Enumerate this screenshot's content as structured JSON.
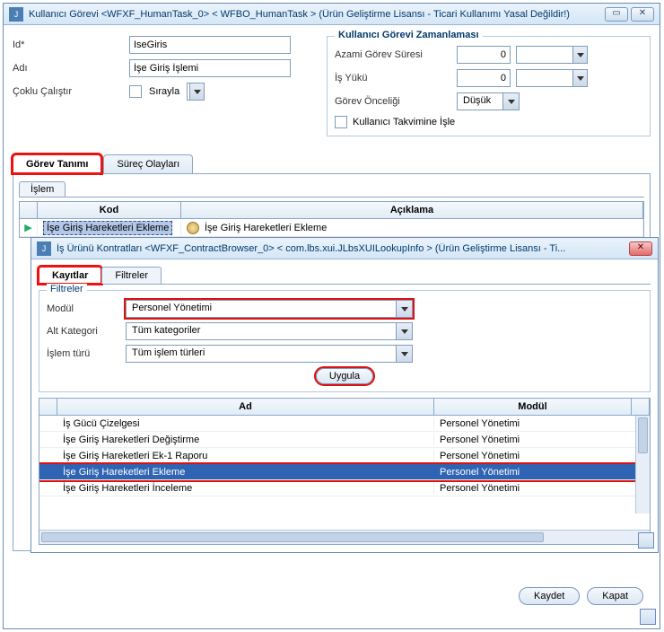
{
  "main_window": {
    "title": "Kullanıcı Görevi <WFXF_HumanTask_0> < WFBO_HumanTask > (Ürün Geliştirme Lisansı - Ticari Kullanımı Yasal Değildir!)"
  },
  "form": {
    "id_label": "Id*",
    "id_value": "IseGiris",
    "name_label": "Adı",
    "name_value": "İşe Giriş İşlemi",
    "multirun_label": "Çoklu Çalıştır",
    "sequential_label": "Sırayla"
  },
  "scheduling": {
    "legend": "Kullanıcı Görevi Zamanlaması",
    "max_duration_label": "Azami Görev Süresi",
    "max_duration_value": "0",
    "workload_label": "İş Yükü",
    "workload_value": "0",
    "priority_label": "Görev Önceliği",
    "priority_value": "Düşük",
    "process_user_calendar_label": "Kullanıcı Takvimine İşle"
  },
  "tabs": {
    "task_def": "Görev Tanımı",
    "process_events": "Süreç Olayları",
    "islem": "İşlem"
  },
  "islem_table": {
    "col_kod": "Kod",
    "col_aciklama": "Açıklama",
    "row1_kod": "İşe Giriş Hareketleri Ekleme",
    "row1_aciklama": "İşe Giriş Hareketleri Ekleme"
  },
  "popup": {
    "title": "İş Ürünü Kontratları <WFXF_ContractBrowser_0> < com.lbs.xui.JLbsXUILookupInfo > (Ürün Geliştirme Lisansı - Ti...",
    "tab_records": "Kayıtlar",
    "tab_filters": "Filtreler",
    "filters_legend": "Filtreler",
    "module_label": "Modül",
    "module_value": "Personel Yönetimi",
    "subcat_label": "Alt Kategori",
    "subcat_value": "Tüm kategoriler",
    "optype_label": "İşlem türü",
    "optype_value": "Tüm işlem türleri",
    "apply_label": "Uygula",
    "col_ad": "Ad",
    "col_modul": "Modül",
    "rows": [
      {
        "ad": "İş Gücü Çizelgesi",
        "mod": "Personel Yönetimi"
      },
      {
        "ad": "İşe Giriş Hareketleri Değiştirme",
        "mod": "Personel Yönetimi"
      },
      {
        "ad": "İşe Giriş Hareketleri Ek-1 Raporu",
        "mod": "Personel Yönetimi"
      },
      {
        "ad": "İşe Giriş Hareketleri Ekleme",
        "mod": "Personel Yönetimi"
      },
      {
        "ad": "İşe Giriş Hareketleri İnceleme",
        "mod": "Personel Yönetimi"
      }
    ]
  },
  "footer": {
    "save": "Kaydet",
    "close": "Kapat"
  }
}
